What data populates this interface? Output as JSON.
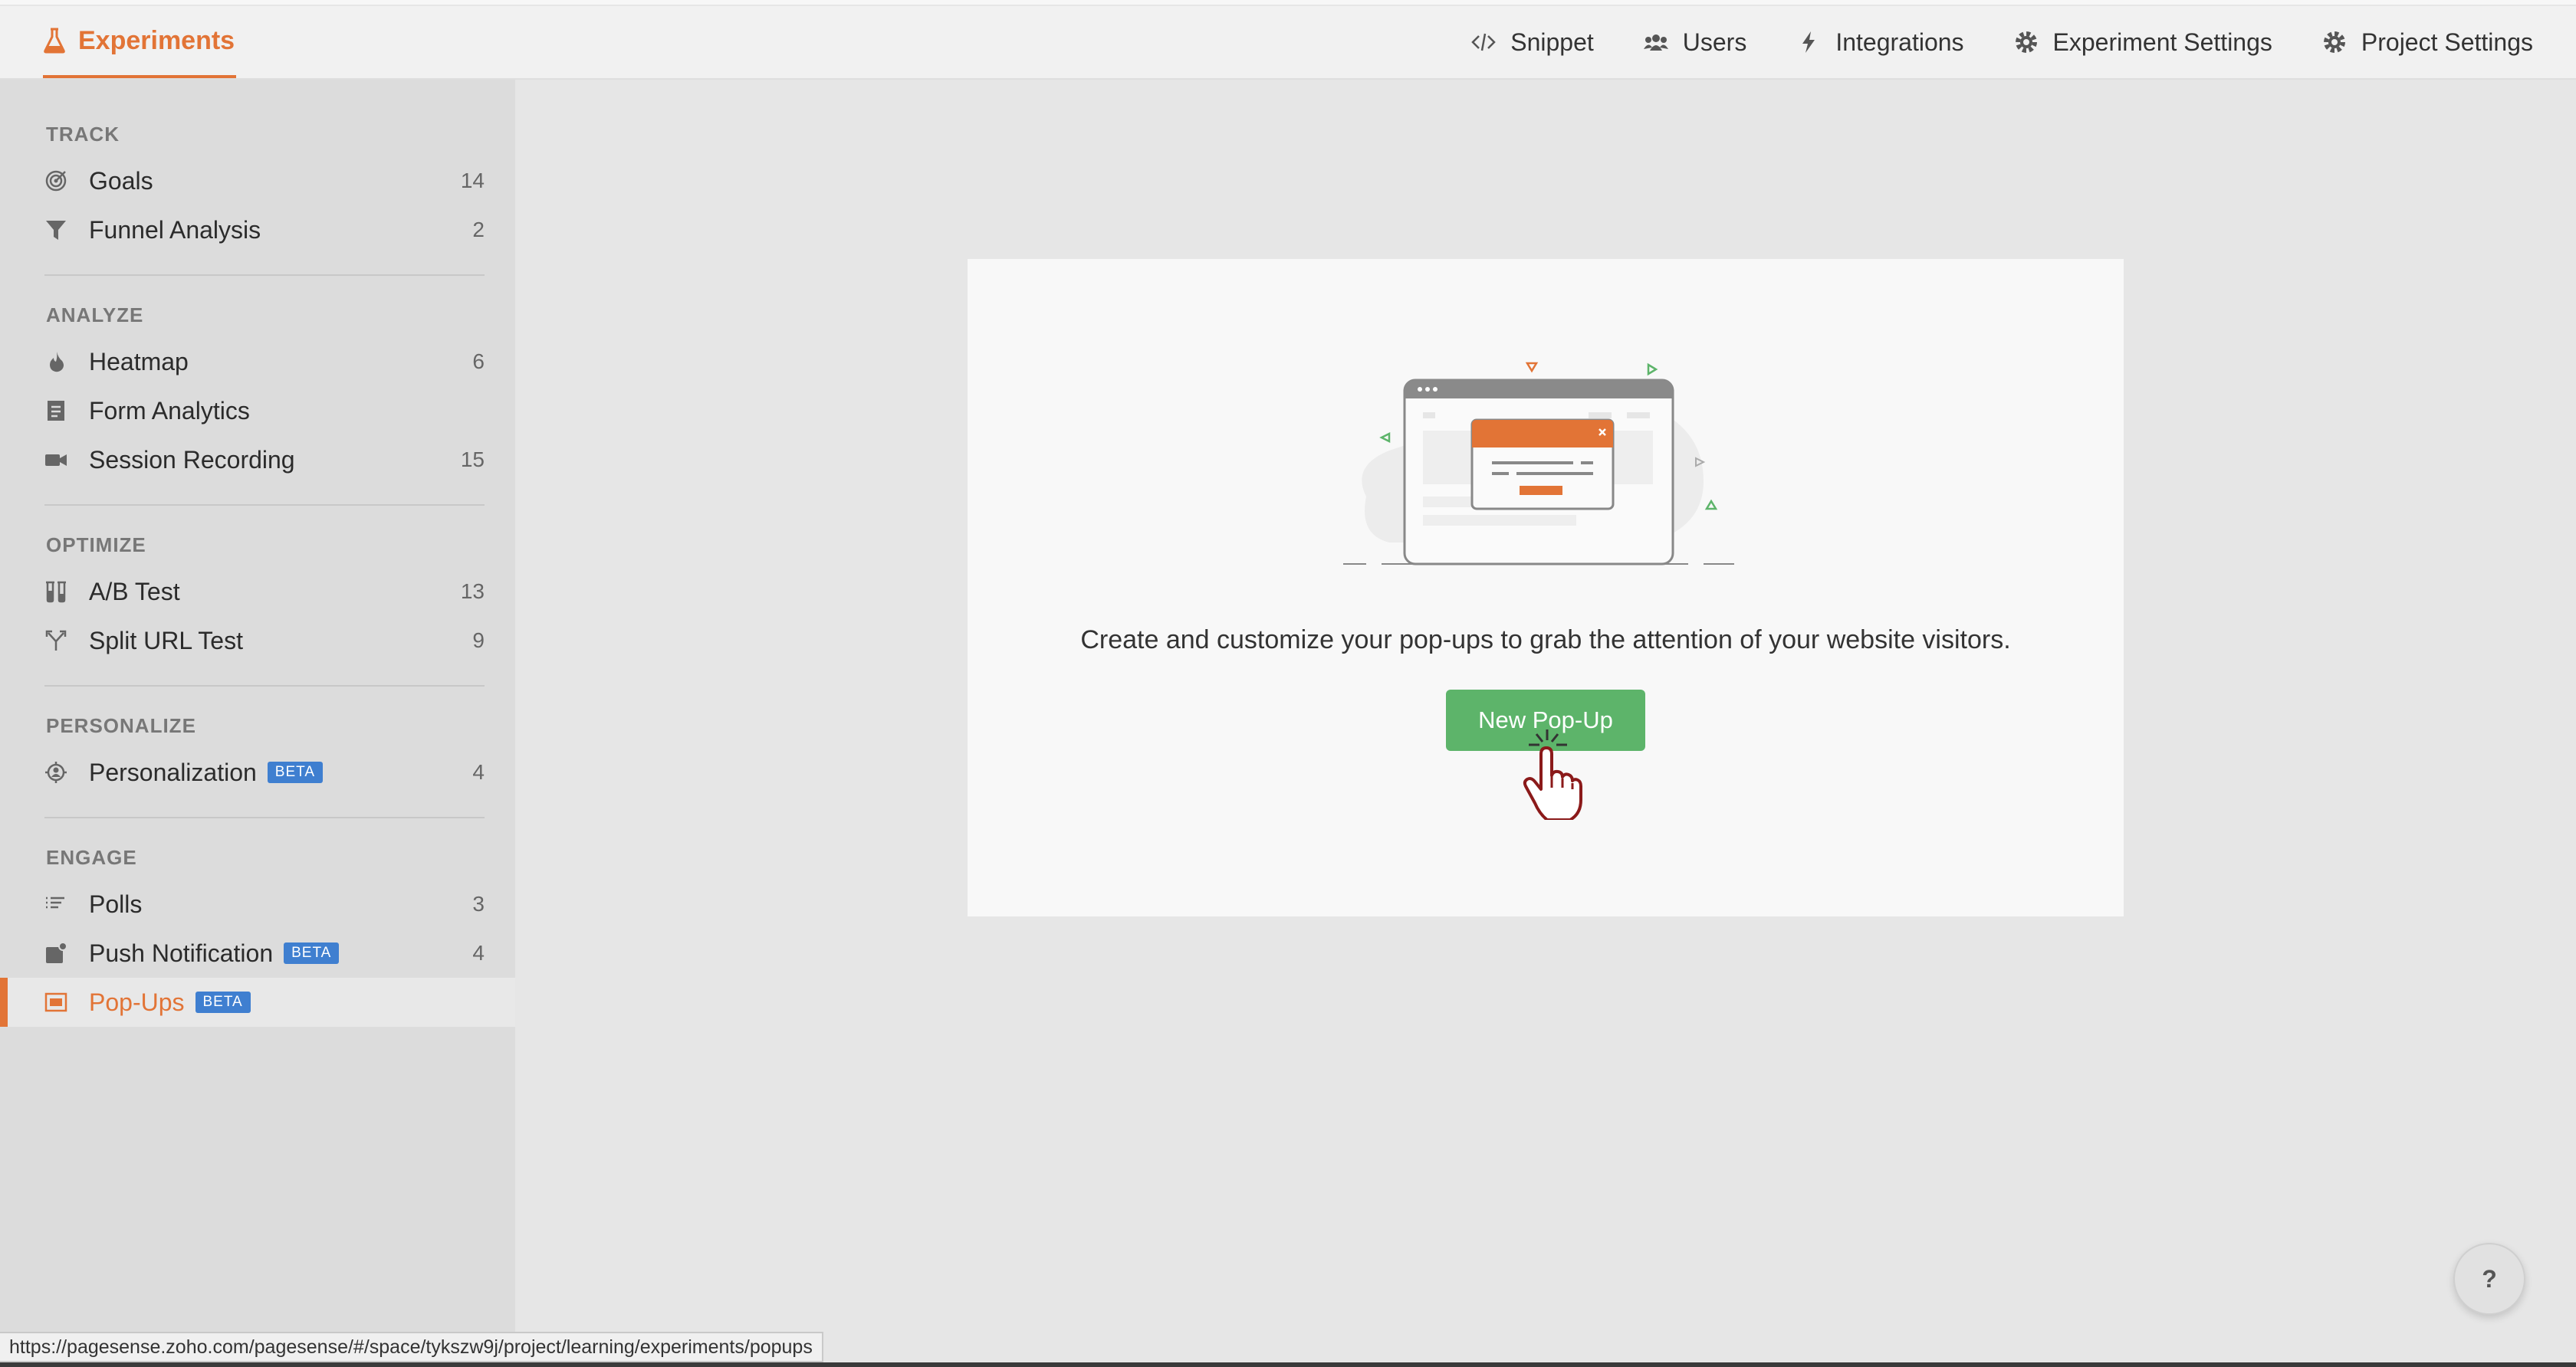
{
  "header": {
    "brand_label": "Experiments",
    "nav": [
      {
        "label": "Snippet",
        "icon": "code-icon"
      },
      {
        "label": "Users",
        "icon": "users-icon"
      },
      {
        "label": "Integrations",
        "icon": "bolt-icon"
      },
      {
        "label": "Experiment Settings",
        "icon": "gear-icon"
      },
      {
        "label": "Project Settings",
        "icon": "gear-icon"
      }
    ]
  },
  "sidebar": {
    "sections": [
      {
        "title": "TRACK",
        "items": [
          {
            "label": "Goals",
            "count": "14",
            "icon": "target-icon"
          },
          {
            "label": "Funnel Analysis",
            "count": "2",
            "icon": "funnel-icon"
          }
        ]
      },
      {
        "title": "ANALYZE",
        "items": [
          {
            "label": "Heatmap",
            "count": "6",
            "icon": "flame-icon"
          },
          {
            "label": "Form Analytics",
            "count": "",
            "icon": "form-icon"
          },
          {
            "label": "Session Recording",
            "count": "15",
            "icon": "video-icon"
          }
        ]
      },
      {
        "title": "OPTIMIZE",
        "items": [
          {
            "label": "A/B Test",
            "count": "13",
            "icon": "ab-test-icon"
          },
          {
            "label": "Split URL Test",
            "count": "9",
            "icon": "split-icon"
          }
        ]
      },
      {
        "title": "PERSONALIZE",
        "items": [
          {
            "label": "Personalization",
            "count": "4",
            "icon": "personalize-icon",
            "badge": "BETA"
          }
        ]
      },
      {
        "title": "ENGAGE",
        "items": [
          {
            "label": "Polls",
            "count": "3",
            "icon": "poll-icon"
          },
          {
            "label": "Push Notification",
            "count": "4",
            "icon": "push-icon",
            "badge": "BETA"
          },
          {
            "label": "Pop-Ups",
            "count": "",
            "icon": "popup-icon",
            "badge": "BETA",
            "active": true
          }
        ]
      }
    ]
  },
  "main": {
    "message": "Create and customize your pop-ups to grab the attention of your website visitors.",
    "button_label": "New Pop-Up"
  },
  "status_url": "https://pagesense.zoho.com/pagesense/#/space/tykszw9j/project/learning/experiments/popups",
  "help_label": "?",
  "colors": {
    "accent": "#e27436",
    "button": "#5db46a",
    "beta": "#3f7fd0"
  }
}
